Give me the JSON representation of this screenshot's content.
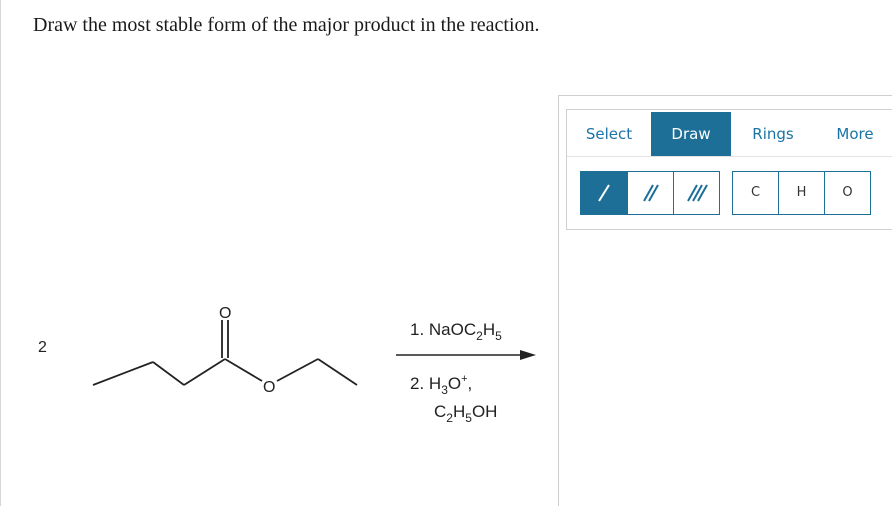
{
  "question": {
    "text": "Draw the most stable form of the major product in the reaction."
  },
  "reaction": {
    "coefficient": "2",
    "ester_oxygen_carbonyl": "O",
    "ester_oxygen_ether": "O",
    "step1_prefix": "1. NaOC",
    "step1_sub1": "2",
    "step1_mid": "H",
    "step1_sub2": "5",
    "step2_prefix": "2. H",
    "step2_sub": "3",
    "step2_mid": "O",
    "step2_sup": "+",
    "step2_suffix": ",",
    "step3_a": "C",
    "step3_sub1": "2",
    "step3_b": "H",
    "step3_sub2": "5",
    "step3_c": "OH"
  },
  "editor": {
    "tabs": [
      "Select",
      "Draw",
      "Rings",
      "More"
    ],
    "active_tab": "Draw",
    "bond_tools": [
      "single-bond-icon",
      "double-bond-icon",
      "triple-bond-icon"
    ],
    "active_bond": "single-bond-icon",
    "atoms": [
      "C",
      "H",
      "O"
    ],
    "accent_color": "#1d6f97"
  }
}
